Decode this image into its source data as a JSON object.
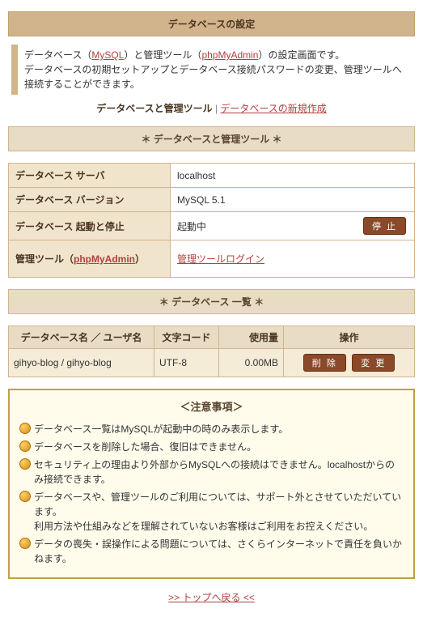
{
  "header": {
    "title": "データベースの設定"
  },
  "intro": {
    "prefix": "データベース（",
    "link1": "MySQL",
    "mid1": "）と管理ツール（",
    "link2": "phpMyAdmin",
    "suffix1": "）の設定画面です。",
    "line2": "データベースの初期セットアップとデータベース接続パスワードの変更、管理ツールへ接続することができます。"
  },
  "subnav": {
    "current": "データベースと管理ツール",
    "sep": " | ",
    "link": "データベースの新規作成"
  },
  "section1": {
    "title": "＊ データベースと管理ツール ＊"
  },
  "info": {
    "server_label": "データベース サーバ",
    "server_value": "localhost",
    "version_label": "データベース バージョン",
    "version_value": "MySQL 5.1",
    "status_label": "データベース 起動と停止",
    "status_value": "起動中",
    "stop_btn": "停 止",
    "admin_label_prefix": "管理ツール（",
    "admin_label_link": "phpMyAdmin",
    "admin_label_suffix": "）",
    "admin_link": "管理ツールログイン"
  },
  "section2": {
    "title": "＊ データベース 一覧 ＊"
  },
  "list": {
    "cols": {
      "name": "データベース名 ／ ユーザ名",
      "enc": "文字コード",
      "usage": "使用量",
      "ops": "操作"
    },
    "row": {
      "name": "gihyo-blog / gihyo-blog",
      "enc": "UTF-8",
      "usage": "0.00MB",
      "delete_btn": "削 除",
      "change_btn": "変 更"
    }
  },
  "notes": {
    "title": "＜注意事項＞",
    "items": [
      "データベース一覧はMySQLが起動中の時のみ表示します。",
      "データベースを削除した場合、復旧はできません。",
      "セキュリティ上の理由より外部からMySQLへの接続はできません。localhostからのみ接続できます。",
      "データベースや、管理ツールのご利用については、サポート外とさせていただいています。\n利用方法や仕組みなどを理解されていないお客様はご利用をお控えください。",
      "データの喪失・誤操作による問題については、さくらインターネットで責任を負いかねます。"
    ]
  },
  "back": {
    "label": ">> トップへ戻る <<"
  }
}
